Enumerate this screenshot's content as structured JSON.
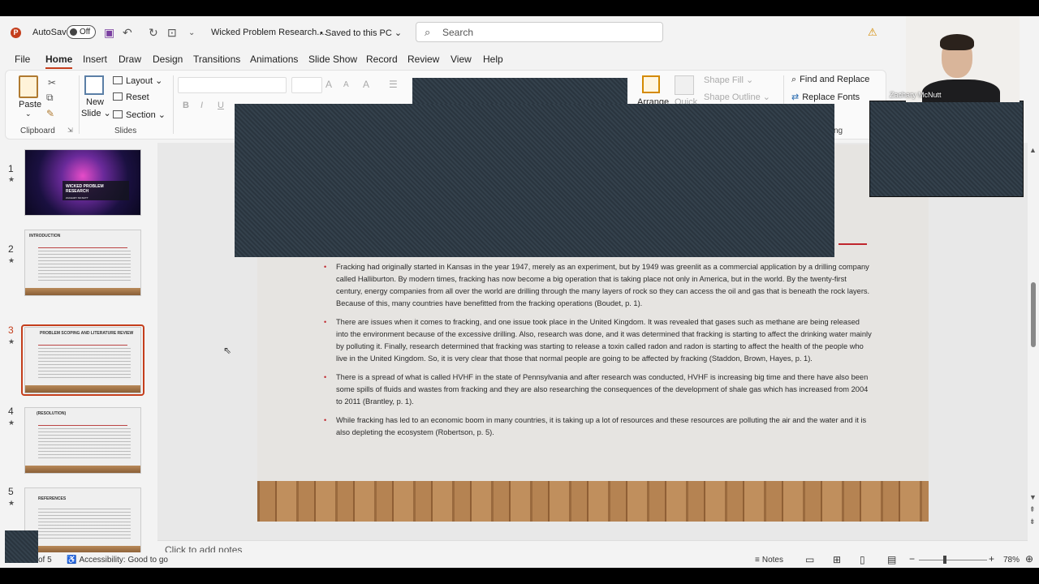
{
  "app": {
    "logo_letter": "P",
    "autosave_label": "AutoSave",
    "autosave_state": "Off",
    "doc_title": "Wicked Problem Research....",
    "saved_status": "• Saved to this PC ⌄",
    "search_placeholder": "Search",
    "warning_icon": "warning-icon"
  },
  "tabs": [
    "File",
    "Home",
    "Insert",
    "Draw",
    "Design",
    "Transitions",
    "Animations",
    "Slide Show",
    "Record",
    "Review",
    "View",
    "Help"
  ],
  "ribbon": {
    "clipboard": {
      "paste": "Paste",
      "label": "Clipboard"
    },
    "slides": {
      "new_slide_1": "New",
      "new_slide_2": "Slide ⌄",
      "layout": "Layout ⌄",
      "reset": "Reset",
      "section": "Section ⌄",
      "label": "Slides"
    },
    "font": {
      "bold": "B",
      "italic": "I",
      "underline": "U"
    },
    "drawing": {
      "arrange": "Arrange",
      "quick": "Quick",
      "shape_fill": "Shape Fill ⌄",
      "shape_outline": "Shape Outline ⌄",
      "label_tail": "ng"
    },
    "editing": {
      "find_replace": "Find and Replace",
      "replace_fonts": "Replace Fonts"
    }
  },
  "thumbnails": [
    {
      "num": "1",
      "title": "WICKED PROBLEM RESEARCH",
      "subtitle": "ZACHARY MCNUTT"
    },
    {
      "num": "2",
      "title": "INTRODUCTION"
    },
    {
      "num": "3",
      "title": "PROBLEM SCOPING AND LITERATURE REVIEW"
    },
    {
      "num": "4",
      "title": "(RESOLUTION)"
    },
    {
      "num": "5",
      "title": "REFERENCES"
    }
  ],
  "slide": {
    "bullets": [
      "Fracking had originally started in Kansas in the year 1947, merely as an experiment, but by 1949 was greenlit as a commercial application by a drilling company called Halliburton.  By modern times, fracking has now become a big operation that is taking place not only in America, but in the world.  By the twenty-first century, energy companies from all over the world are drilling through the many layers of rock so they can access the oil and gas that is beneath the rock layers.  Because of this, many countries have benefitted from the fracking operations (Boudet, p. 1).",
      "There are issues when it comes to fracking, and one issue took place in the United Kingdom.  It was revealed that gases such as methane are being released into the environment because of the excessive drilling.  Also, research was done, and it was determined that fracking is starting to affect the drinking water mainly by polluting it.  Finally, research determined that fracking was starting to release a toxin called radon and radon is starting to affect the health of the people who live in the United Kingdom.  So, it is very clear that those that normal people are going to be affected by fracking (Staddon, Brown, Hayes, p. 1).",
      "There is a spread of what is called HVHF in the state of Pennsylvania and after research was conducted, HVHF is increasing big time and there have also been some spills of fluids and wastes from fracking and they are also researching the consequences of the development of shale gas which has increased from 2004 to 2011 (Brantley, p. 1).",
      "While fracking has led to an economic boom in many countries, it is taking up a lot of resources and these resources are polluting the air and the water and it is also depleting the ecosystem (Robertson, p. 5)."
    ]
  },
  "notes_placeholder": "Click to add notes",
  "status": {
    "slide_count": "of 5",
    "accessibility": "Accessibility: Good to go",
    "notes": "Notes",
    "zoom": "78%"
  },
  "webcam": {
    "name": "Zachary McNutt"
  }
}
